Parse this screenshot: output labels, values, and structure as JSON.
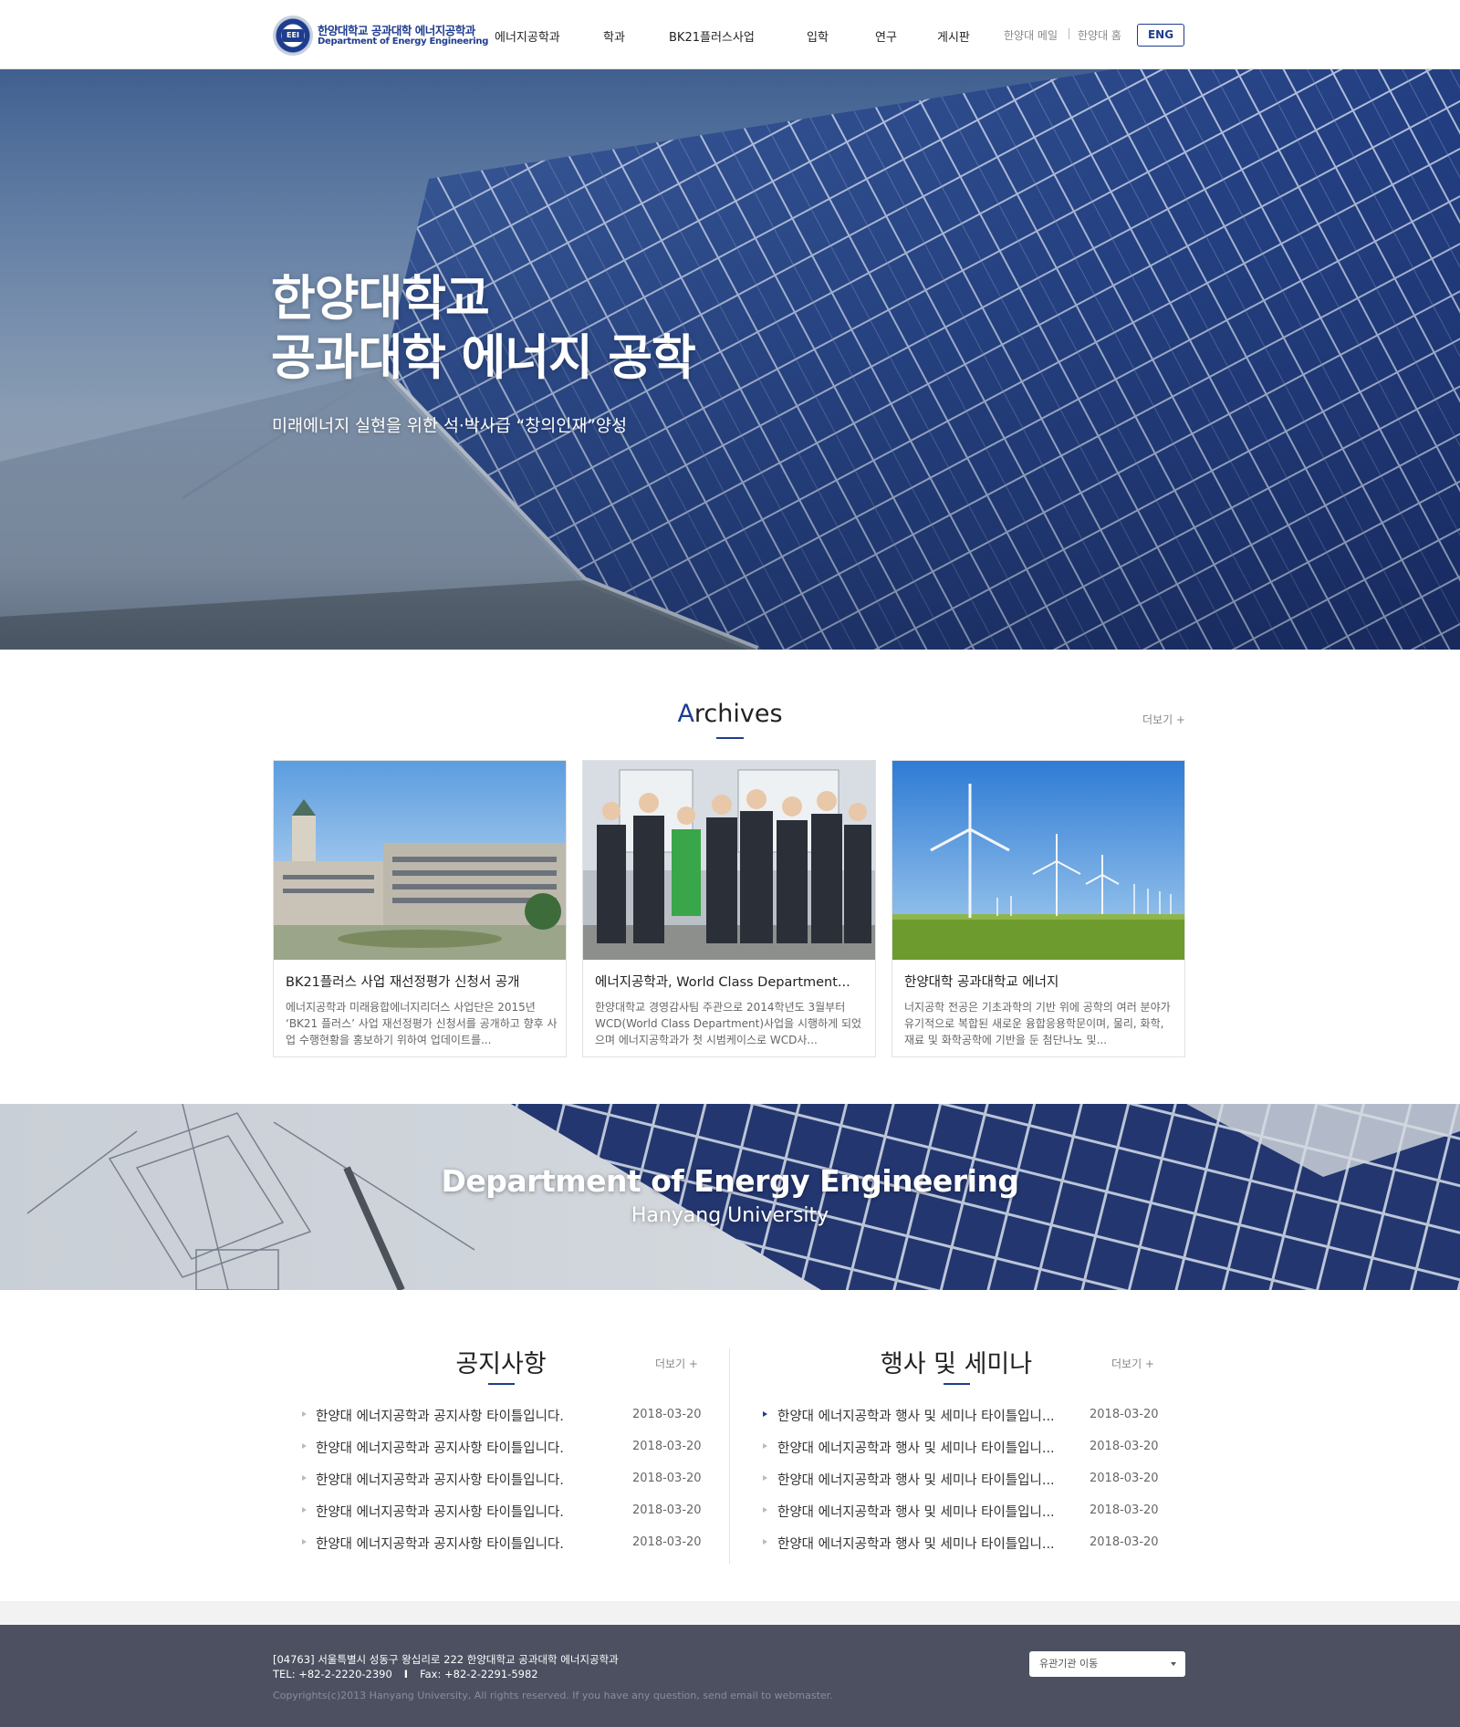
{
  "header": {
    "logo_ko": "한양대학교 공과대학 에너지공학과",
    "logo_en": "Department of Energy Engineering",
    "nav": [
      "에너지공학과",
      "학과",
      "BK21플러스사업",
      "입학",
      "연구",
      "게시판"
    ],
    "util": [
      "한양대 메일",
      "한양대 홈"
    ],
    "eng_label": "ENG"
  },
  "hero": {
    "title_line1": "한양대학교",
    "title_line2": "공과대학 에너지 공학",
    "subtitle": "미래에너지 실현을 위한 석·박사급 “창의인재”양성"
  },
  "archives": {
    "title_first": "A",
    "title_rest": "rchives",
    "more": "더보기 +",
    "cards": [
      {
        "title": "BK21플러스 사업 재선정평가 신청서 공개",
        "desc": "에너지공학과 미래융합에너지리더스 사업단은 2015년 ‘BK21 플러스’ 사업 재선정평가 신청서를 공개하고 향후 사업 수행현황을 홍보하기 위하여 업데이트를..."
      },
      {
        "title": "에너지공학과, World Class Department...",
        "desc": "한양대학교 경영감사팀 주관으로 2014학년도 3월부터 WCD(World Class Department)사업을 시행하게 되었으며 에너지공학과가 첫 시범케이스로 WCD사..."
      },
      {
        "title": "한양대학 공과대학교 에너지",
        "desc": "너지공학 전공은 기초과학의 기반 위에 공학의 여러 분야가 유기적으로 복합된 새로운 융합응용학문이며, 물리, 화학, 재료 및 화학공학에 기반을 둔 첨단나노 및..."
      }
    ]
  },
  "banner": {
    "title": "Department of Energy Engineering",
    "subtitle": "Hanyang University"
  },
  "notice": {
    "title": "공지사항",
    "more": "더보기 +",
    "items": [
      {
        "title": "한양대 에너지공학과 공지사항 타이틀입니다.",
        "date": "2018-03-20"
      },
      {
        "title": "한양대 에너지공학과 공지사항 타이틀입니다.",
        "date": "2018-03-20"
      },
      {
        "title": "한양대 에너지공학과 공지사항 타이틀입니다.",
        "date": "2018-03-20"
      },
      {
        "title": "한양대 에너지공학과 공지사항 타이틀입니다.",
        "date": "2018-03-20"
      },
      {
        "title": "한양대 에너지공학과 공지사항 타이틀입니다.",
        "date": "2018-03-20"
      }
    ]
  },
  "events": {
    "title": "행사 및 세미나",
    "more": "더보기 +",
    "items": [
      {
        "title": "한양대 에너지공학과 행사 및 세미나 타이틀입니...",
        "date": "2018-03-20"
      },
      {
        "title": "한양대 에너지공학과 행사 및 세미나 타이틀입니...",
        "date": "2018-03-20"
      },
      {
        "title": "한양대 에너지공학과 행사 및 세미나 타이틀입니...",
        "date": "2018-03-20"
      },
      {
        "title": "한양대 에너지공학과 행사 및 세미나 타이틀입니...",
        "date": "2018-03-20"
      },
      {
        "title": "한양대 에너지공학과 행사 및 세미나 타이틀입니...",
        "date": "2018-03-20"
      }
    ]
  },
  "footer": {
    "address": "[04763] 서울특별시 성동구 왕십리로 222 한양대학교 공과대학 에너지공학과",
    "tel": "TEL: +82-2-2220-2390",
    "fax": "Fax: +82-2-2291-5982",
    "copyright": "Copyrights(c)2013 Hanyang University, All rights reserved. If you have any question, send email to webmaster.",
    "select_label": "유관기관 이동"
  },
  "colors": {
    "brand": "#1e3d8f",
    "footer_bg": "#4c5060"
  }
}
